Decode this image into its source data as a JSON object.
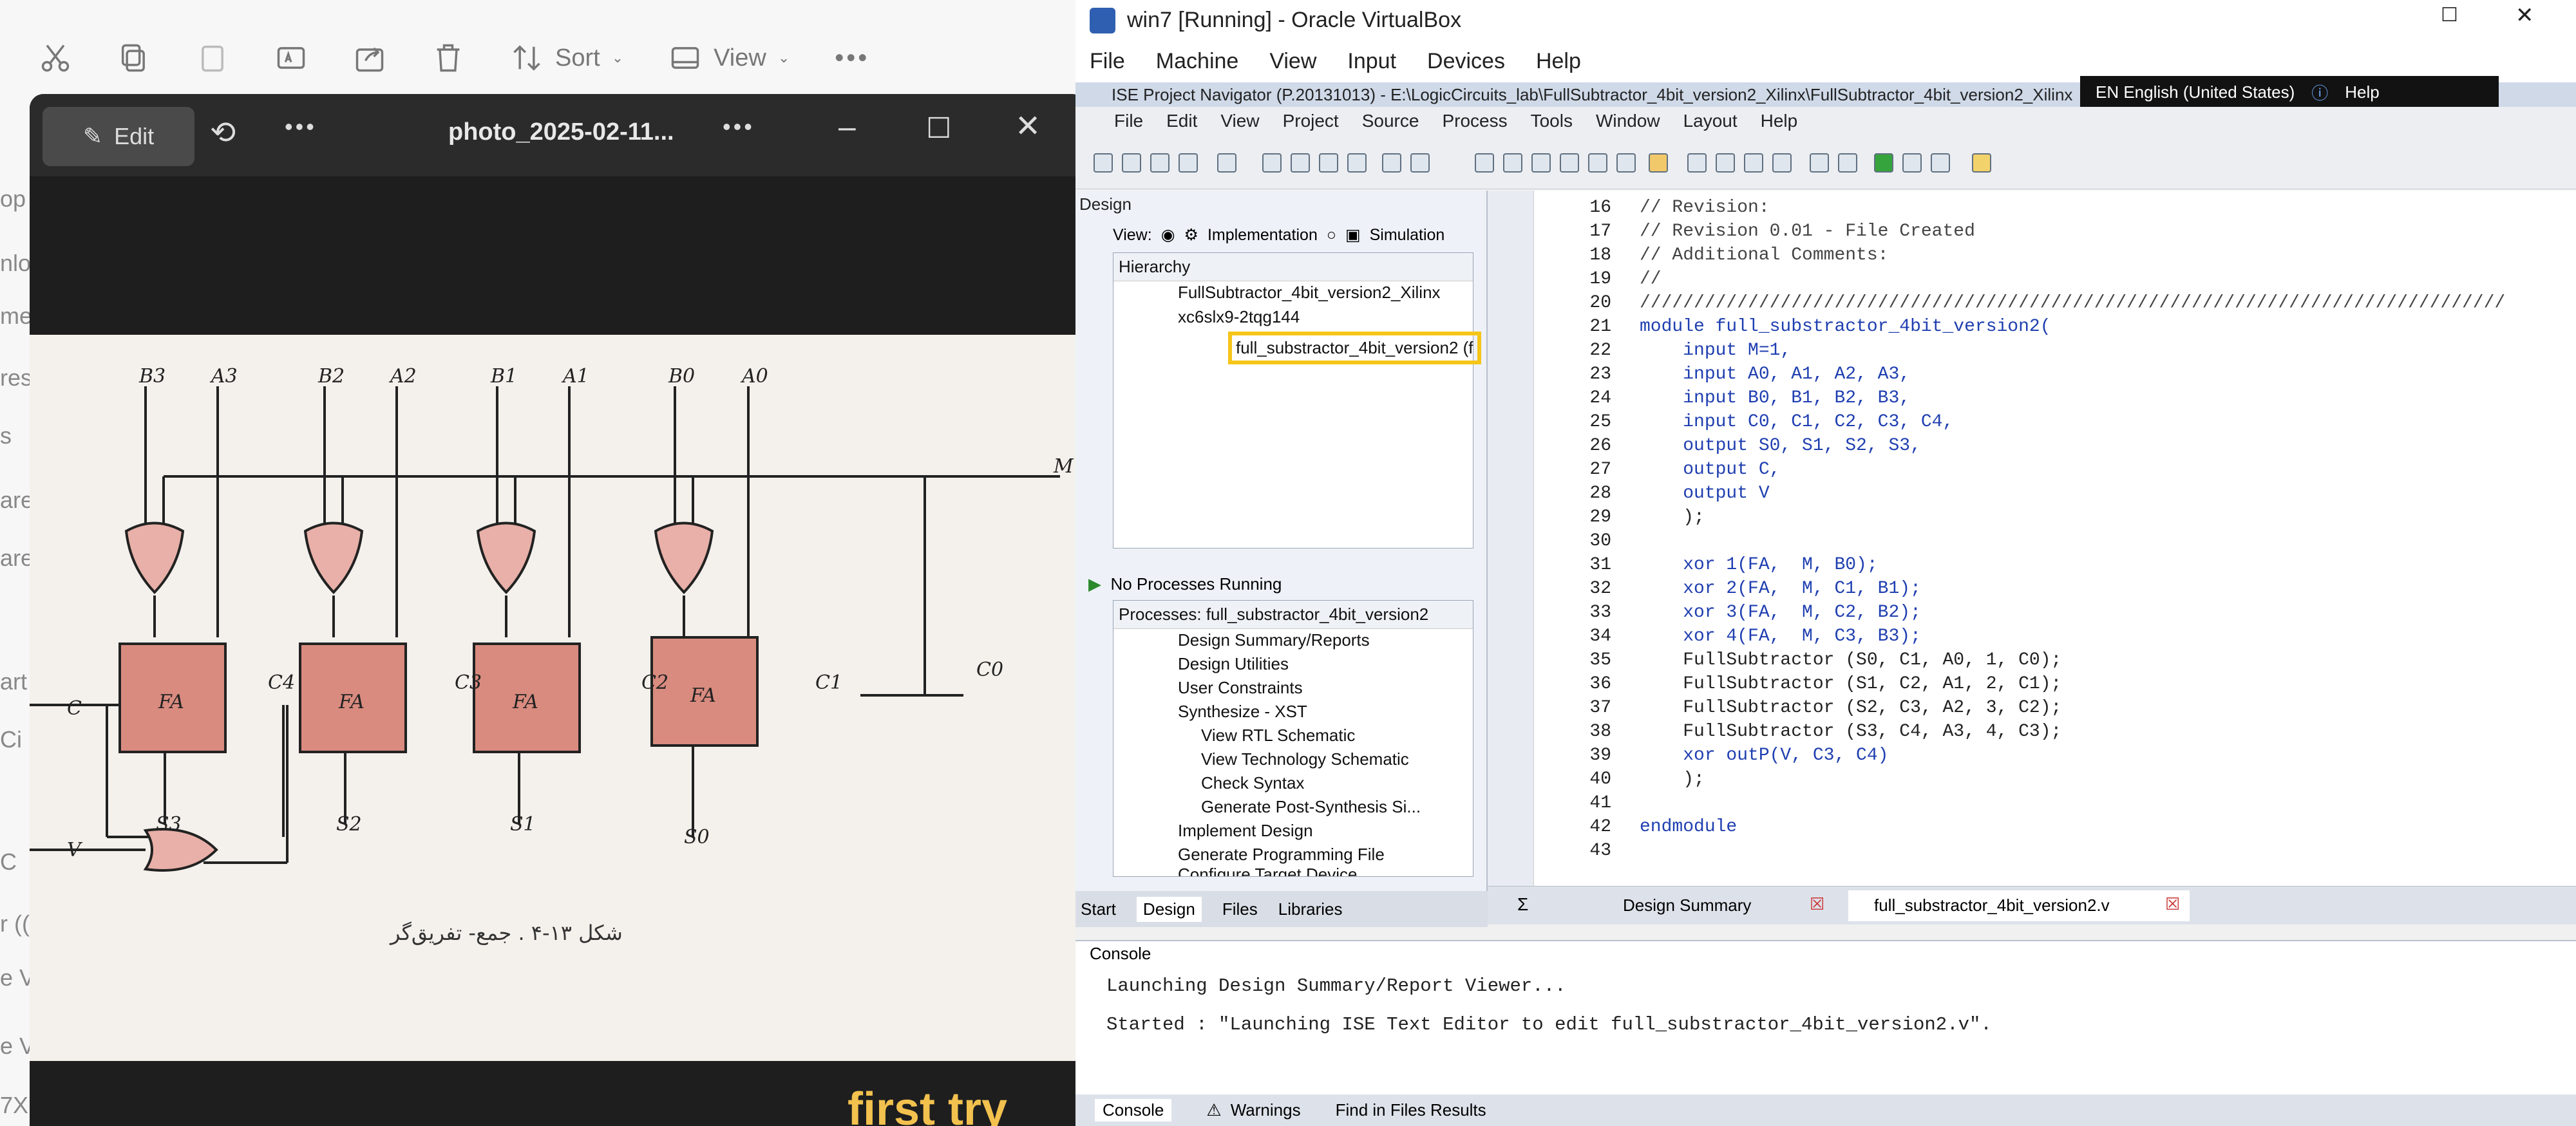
{
  "explorer": {
    "toolbar": {
      "sort_label": "Sort",
      "view_label": "View"
    },
    "left_fragments": [
      "op",
      "nlo",
      "me",
      "res",
      "s",
      "are",
      "are",
      "art",
      "Ci",
      "C",
      "r ((",
      "e V",
      "e V",
      "7X"
    ]
  },
  "photo_viewer": {
    "edit_label": "Edit",
    "filename": "photo_2025-02-11...",
    "caption": "first try",
    "figure": {
      "top_labels": [
        "B3",
        "A3",
        "B2",
        "A2",
        "B1",
        "A1",
        "B0",
        "A0"
      ],
      "fa_label": "FA",
      "carry_labels": [
        "C4",
        "C3",
        "C2",
        "C1",
        "C0"
      ],
      "sum_labels": [
        "S3",
        "S2",
        "S1",
        "S0"
      ],
      "m_label": "M",
      "c_label": "C",
      "v_label": "V",
      "figure_caption": "شکل ۱۳-۴ . جمع- تفریق‌گر"
    }
  },
  "virtualbox": {
    "title": "win7 [Running] - Oracle VirtualBox",
    "menu": [
      "File",
      "Machine",
      "View",
      "Input",
      "Devices",
      "Help"
    ],
    "language": "EN English (United States)",
    "help": "Help"
  },
  "ise": {
    "title": "ISE Project Navigator (P.20131013) - E:\\LogicCircuits_lab\\FullSubtractor_4bit_version2_Xilinx\\FullSubtractor_4bit_version2_Xilinx",
    "menu": [
      "File",
      "Edit",
      "View",
      "Project",
      "Source",
      "Process",
      "Tools",
      "Window",
      "Layout",
      "Help"
    ],
    "design": {
      "header": "Design",
      "view_label": "View:",
      "implementation": "Implementation",
      "simulation": "Simulation",
      "hierarchy": "Hierarchy",
      "tree": [
        "FullSubtractor_4bit_version2_Xilinx",
        "xc6slx9-2tqg144",
        "full_substractor_4bit_version2 (f"
      ],
      "no_processes": "No Processes Running",
      "processes_header": "Processes: full_substractor_4bit_version2",
      "processes": [
        "Design Summary/Reports",
        "Design Utilities",
        "User Constraints",
        "Synthesize - XST",
        "View RTL Schematic",
        "View Technology Schematic",
        "Check Syntax",
        "Generate Post-Synthesis Si...",
        "Implement Design",
        "Generate Programming File",
        "Configure Target Device"
      ],
      "bottom_tabs": [
        "Start",
        "Design",
        "Files",
        "Libraries"
      ]
    },
    "editor": {
      "line_numbers": [
        "16",
        "17",
        "18",
        "19",
        "20",
        "21",
        "22",
        "23",
        "24",
        "25",
        "26",
        "27",
        "28",
        "29",
        "30",
        "31",
        "32",
        "33",
        "34",
        "35",
        "36",
        "37",
        "38",
        "39",
        "40",
        "41",
        "42",
        "43"
      ],
      "lines": [
        "// Revision:",
        "// Revision 0.01 - File Created",
        "// Additional Comments:",
        "//",
        "////////////////////////////////////////////////////////////////////////////////",
        "module full_substractor_4bit_version2(",
        "    input M=1,",
        "    input A0, A1, A2, A3,",
        "    input B0, B1, B2, B3,",
        "    input C0, C1, C2, C3, C4,",
        "    output S0, S1, S2, S3,",
        "    output C,",
        "    output V",
        "    );",
        "",
        "    xor 1(FA,  M, B0);",
        "    xor 2(FA,  M, C1, B1);",
        "    xor 3(FA,  M, C2, B2);",
        "    xor 4(FA,  M, C3, B3);",
        "    FullSubtractor (S0, C1, A0, 1, C0);",
        "    FullSubtractor (S1, C2, A1, 2, C1);",
        "    FullSubtractor (S2, C3, A2, 3, C2);",
        "    FullSubtractor (S3, C4, A3, 4, C3);",
        "    xor outP(V, C3, C4)",
        "    );",
        "",
        "endmodule",
        ""
      ],
      "tabs": [
        "Design Summary",
        "full_substractor_4bit_version2.v"
      ]
    },
    "console": {
      "header": "Console",
      "lines": [
        "Launching Design Summary/Report Viewer...",
        "Started : \"Launching ISE Text Editor to edit full_substractor_4bit_version2.v\"."
      ],
      "tabs": [
        "Console",
        "Warnings",
        "Find in Files Results"
      ]
    }
  }
}
